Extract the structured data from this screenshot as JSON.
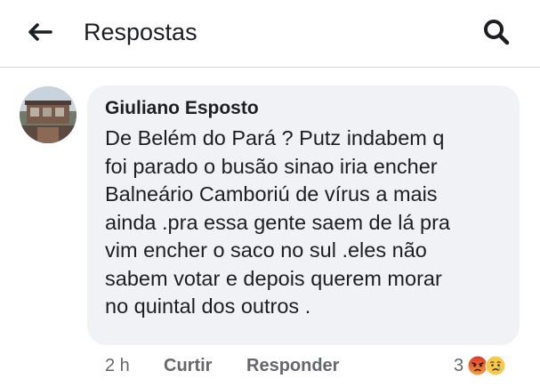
{
  "header": {
    "title": "Respostas",
    "back_icon": "arrow-left-icon",
    "search_icon": "search-icon"
  },
  "comment": {
    "author": "Giuliano Esposto",
    "text": "De Belém do Pará  ? Putz indabem q\nfoi parado o busão sinao iria encher\nBalneário Camboriú de vírus a mais\nainda .pra essa gente saem de lá  pra\nvim encher o saco no sul .eles não\nsabem votar e depois querem morar\nno quintal dos outros .",
    "time": "2 h",
    "like_label": "Curtir",
    "reply_label": "Responder",
    "reaction_count": "3",
    "reactions": [
      "angry-reaction-icon",
      "sad-reaction-icon"
    ]
  },
  "colors": {
    "bubble": "#f0f2f5",
    "text": "#1c1e21",
    "secondary": "#65676b"
  }
}
